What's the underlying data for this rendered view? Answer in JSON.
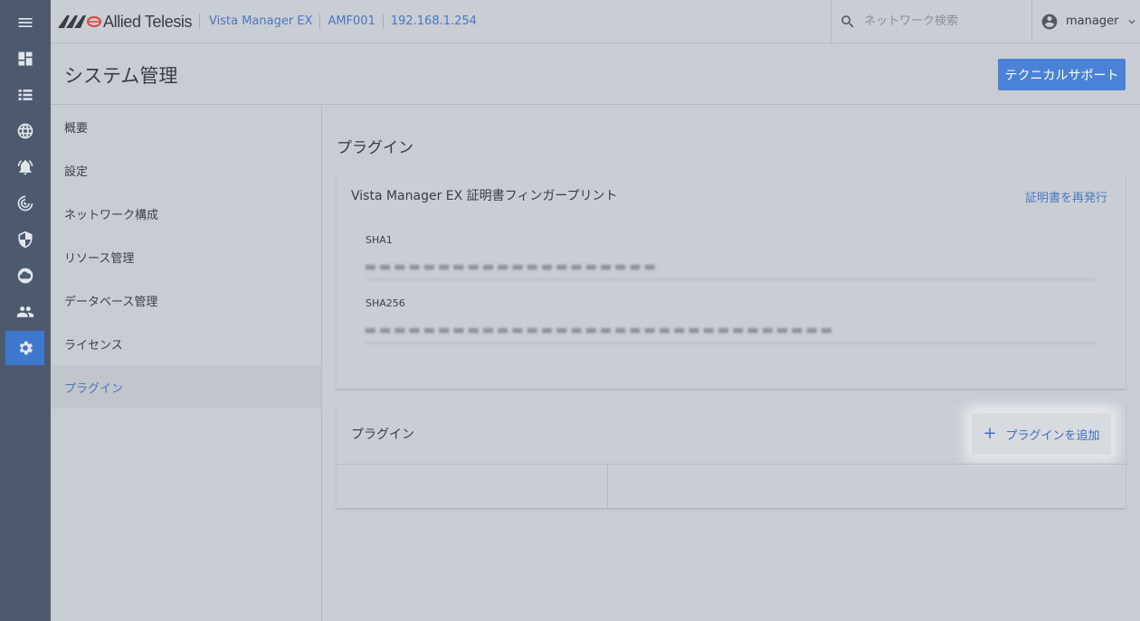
{
  "header": {
    "logo_text": "Allied Telesis",
    "breadcrumbs": [
      "Vista Manager EX",
      "AMF001",
      "192.168.1.254"
    ],
    "search_placeholder": "ネットワーク検索",
    "username": "manager"
  },
  "rail": {
    "items": [
      "menu-icon",
      "dashboard-icon",
      "list-icon",
      "globe-icon",
      "alarm-icon",
      "radar-icon",
      "shield-icon",
      "cloud-upload-icon",
      "people-icon",
      "gear-icon"
    ],
    "active": "gear-icon",
    "accent_color": "#3e78cc"
  },
  "page": {
    "title": "システム管理",
    "support_button": "テクニカルサポート"
  },
  "subnav": {
    "items": [
      "概要",
      "設定",
      "ネットワーク構成",
      "リソース管理",
      "データベース管理",
      "ライセンス",
      "プラグイン"
    ],
    "active_index": 6
  },
  "main": {
    "section_title": "プラグイン",
    "fingerprint_card": {
      "title": "Vista Manager EX 証明書フィンガープリント",
      "reissue_link": "証明書を再発行",
      "sha1_label": "SHA1",
      "sha256_label": "SHA256"
    },
    "plugin_card": {
      "title": "プラグイン",
      "add_button": "プラグインを追加"
    }
  }
}
